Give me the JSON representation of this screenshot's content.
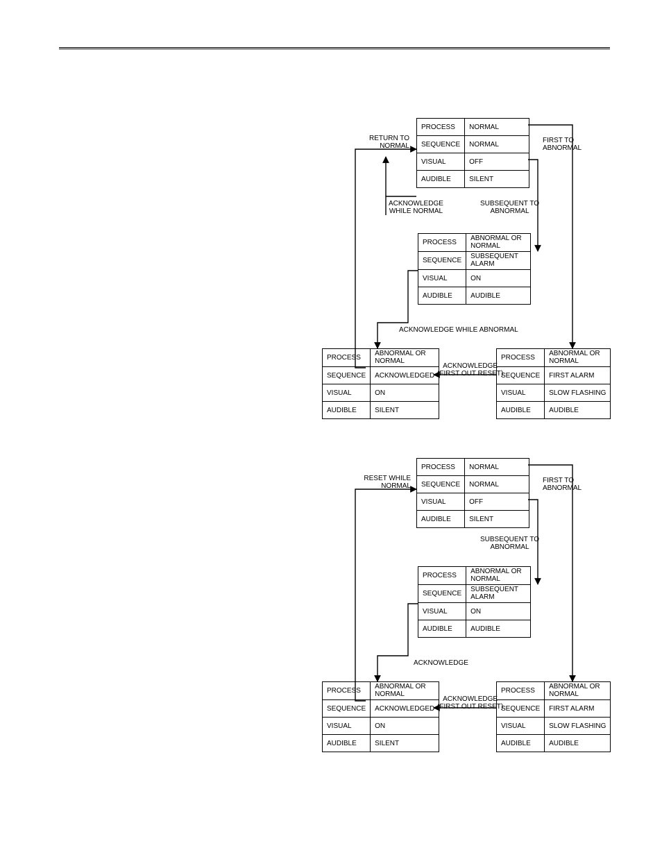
{
  "rows": {
    "process": "PROCESS",
    "sequence": "SEQUENCE",
    "visual": "VISUAL",
    "audible": "AUDIBLE"
  },
  "vals": {
    "normal": "NORMAL",
    "off": "OFF",
    "silent": "SILENT",
    "abnormal_or_normal": "ABNORMAL OR\nNORMAL",
    "subsequent_alarm": "SUBSEQUENT\nALARM",
    "on": "ON",
    "audible": "AUDIBLE",
    "acknowledged": "ACKNOWLEDGED",
    "first_alarm": "FIRST ALARM",
    "slow_flashing": "SLOW FLASHING"
  },
  "labels": {
    "d1": {
      "return_to_normal": "RETURN TO\nNORMAL",
      "first_to_abnormal": "FIRST TO\nABNORMAL",
      "ack_while_normal": "ACKNOWLEDGE\nWHILE NORMAL",
      "subsequent_to_abnormal": "SUBSEQUENT TO\nABNORMAL",
      "ack_while_abnormal": "ACKNOWLEDGE WHILE ABNORMAL",
      "ack_first_out_reset": "ACKNOWLEDGE\n(FIRST OUT RESET)"
    },
    "d2": {
      "reset_while_normal": "RESET WHILE\nNORMAL",
      "first_to_abnormal": "FIRST TO\nABNORMAL",
      "subsequent_to_abnormal": "SUBSEQUENT TO\nABNORMAL",
      "acknowledge": "ACKNOWLEDGE",
      "ack_first_out_reset": "ACKNOWLEDGE\n(FIRST OUT RESET)"
    }
  }
}
